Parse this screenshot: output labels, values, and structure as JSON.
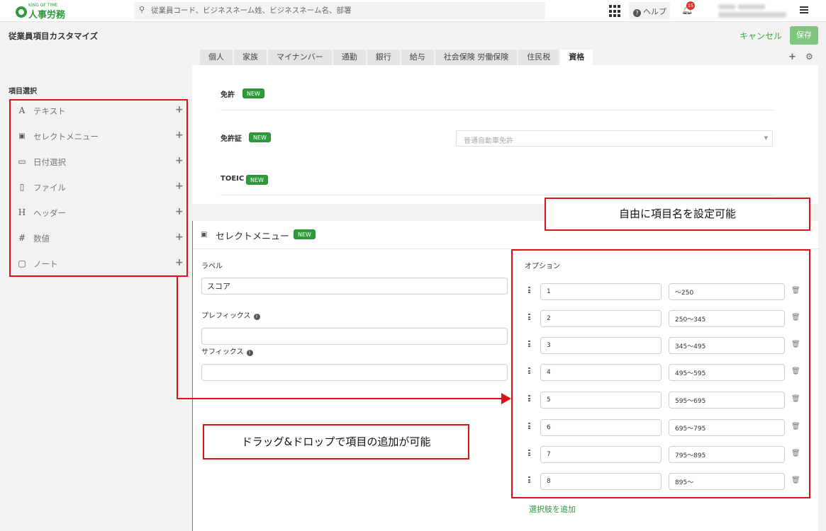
{
  "topbar": {
    "logo_small": "KING OF TIME",
    "logo_text": "人事労務",
    "search_placeholder": "従業員コード、ビジネスネーム姓、ビジネスネーム名、部署",
    "help_label": "ヘルプ",
    "notification_count": "15",
    "icons": [
      "search-icon",
      "apps-grid-icon",
      "help-icon",
      "bell-icon",
      "hamburger-menu-icon"
    ]
  },
  "page": {
    "title": "従業員項目カスタマイズ",
    "cancel_label": "キャンセル",
    "save_label": "保存"
  },
  "tabs": [
    {
      "label": "個人"
    },
    {
      "label": "家族"
    },
    {
      "label": "マイナンバー"
    },
    {
      "label": "通勤"
    },
    {
      "label": "銀行"
    },
    {
      "label": "給与"
    },
    {
      "label": "社会保険 労働保険"
    },
    {
      "label": "住民税"
    },
    {
      "label": "資格",
      "active": true
    }
  ],
  "left_panel": {
    "heading": "項目選択",
    "items": [
      {
        "icon": "A",
        "icon_name": "text-icon",
        "label": "テキスト"
      },
      {
        "icon": "▣",
        "icon_name": "select-menu-icon",
        "label": "セレクトメニュー"
      },
      {
        "icon": "▭",
        "icon_name": "calendar-icon",
        "label": "日付選択"
      },
      {
        "icon": "▯",
        "icon_name": "file-icon",
        "label": "ファイル"
      },
      {
        "icon": "H",
        "icon_name": "header-icon",
        "label": "ヘッダー"
      },
      {
        "icon": "#",
        "icon_name": "number-icon",
        "label": "数値"
      },
      {
        "icon": "▢",
        "icon_name": "note-icon",
        "label": "ノート"
      }
    ],
    "plus_symbol": "+"
  },
  "fields": [
    {
      "name": "免許",
      "badge": "NEW"
    },
    {
      "name": "免許証",
      "badge": "NEW",
      "select_value": "普通自動車免許"
    },
    {
      "name": "TOEIC",
      "badge": "NEW"
    }
  ],
  "editor": {
    "title": "セレクトメニュー",
    "badge": "NEW",
    "label_caption": "ラベル",
    "label_value": "スコア",
    "prefix_caption": "プレフィックス",
    "prefix_value": "",
    "suffix_caption": "サフィックス",
    "suffix_value": "",
    "options_caption": "オプション",
    "options": [
      {
        "value": "1",
        "text": "〜250"
      },
      {
        "value": "2",
        "text": "250〜345"
      },
      {
        "value": "3",
        "text": "345〜495"
      },
      {
        "value": "4",
        "text": "495〜595"
      },
      {
        "value": "5",
        "text": "595〜695"
      },
      {
        "value": "6",
        "text": "695〜795"
      },
      {
        "value": "7",
        "text": "795〜895"
      },
      {
        "value": "8",
        "text": "895〜"
      }
    ],
    "add_choice_label": "選択肢を追加"
  },
  "annotations": {
    "callout_top": "自由に項目名を設定可能",
    "callout_bottom": "ドラッグ&ドロップで項目の追加が可能",
    "color": "#e0101a"
  },
  "colors": {
    "brand_green": "#2e9a3b",
    "save_button": "#7fc47f",
    "annotation_red": "#e0101a"
  }
}
